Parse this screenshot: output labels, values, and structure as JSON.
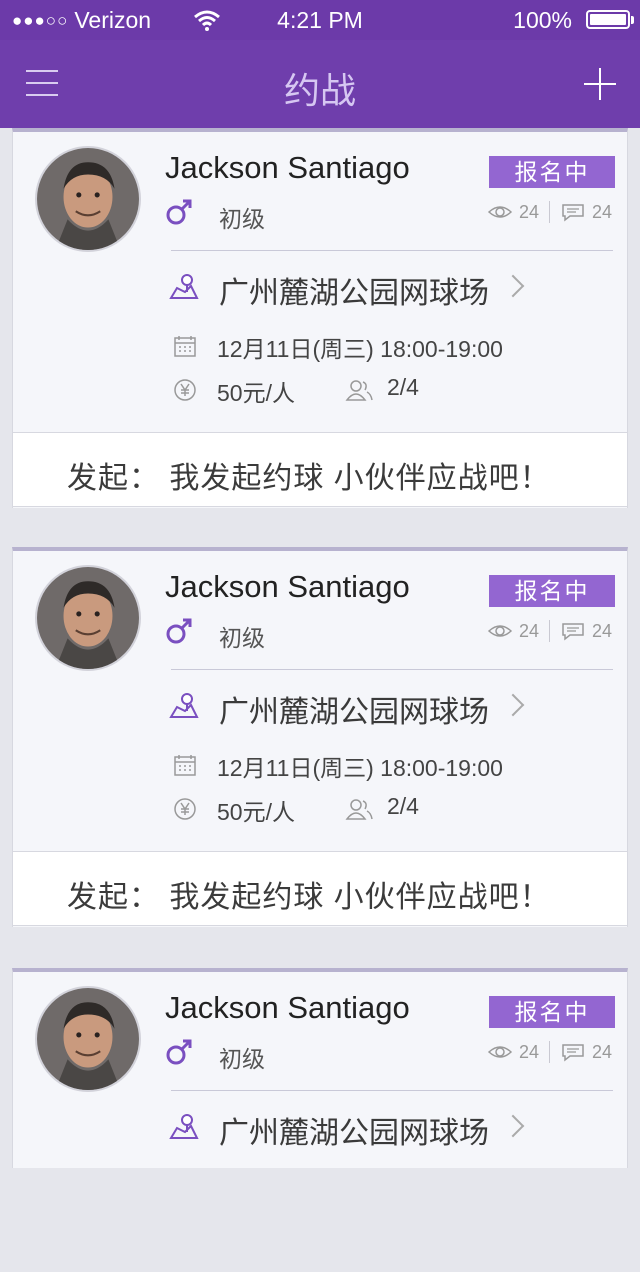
{
  "status_bar": {
    "carrier": "Verizon",
    "signal_dots": "●●●○○",
    "time": "4:21 PM",
    "battery": "100%"
  },
  "nav": {
    "title": "约战",
    "menu_icon": "hamburger-icon",
    "add_icon": "plus-icon"
  },
  "colors": {
    "header": "#6f3eac",
    "badge": "#9366d1",
    "accent": "#7a4fc0"
  },
  "cards": [
    {
      "name": "Jackson Santiago",
      "status": "报名中",
      "level": "初级",
      "views": "24",
      "comments": "24",
      "venue": "广州麓湖公园网球场",
      "datetime": "12月11日(周三)  18:00-19:00",
      "price": "50元/人",
      "participants": "2/4",
      "note": "发起：  我发起约球  小伙伴应战吧！"
    },
    {
      "name": "Jackson Santiago",
      "status": "报名中",
      "level": "初级",
      "views": "24",
      "comments": "24",
      "venue": "广州麓湖公园网球场",
      "datetime": "12月11日(周三)  18:00-19:00",
      "price": "50元/人",
      "participants": "2/4",
      "note": "发起：  我发起约球  小伙伴应战吧！"
    },
    {
      "name": "Jackson Santiago",
      "status": "报名中",
      "level": "初级",
      "views": "24",
      "comments": "24",
      "venue": "广州麓湖公园网球场"
    }
  ]
}
